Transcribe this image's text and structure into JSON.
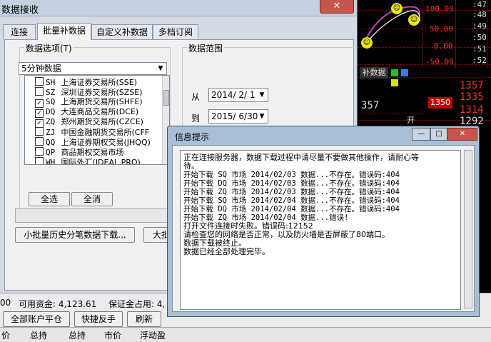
{
  "colors": {
    "accent_red": "#ff3030",
    "dialog_blue": "#a9bfd6",
    "window_frame": "#d4dbe4"
  },
  "background": {
    "right_prices": [
      "100.00",
      "50.00",
      "0.00",
      "-50.00"
    ],
    "far_right_ticks": [
      ":47",
      ":48",
      ":49",
      ":50",
      ":51",
      ":52"
    ],
    "tab_label": "补数据",
    "badge": "1350",
    "price_357": "357",
    "price_list": [
      "1357",
      "1335",
      "1314",
      "1292"
    ],
    "label_open": "开",
    "capital_label": "可用资金: 4,123.61",
    "margin_label": "保证金占用: 4,",
    "left_digits": "00",
    "buttons": [
      "全部账户平仓",
      "快捷反手",
      "刷新"
    ],
    "columns": [
      "价",
      "总持",
      "总持",
      "市价",
      "浮动盈"
    ]
  },
  "main_window": {
    "title": "数据接收",
    "close_icon": "✕",
    "tabs": [
      "连接",
      "批量补数据",
      "自定义补数据",
      "多档订阅"
    ],
    "options_label": "数据选项(T)",
    "period_value": "5分钟数据",
    "dropdown_icon": "▼",
    "checkmark": "✓",
    "exchanges": [
      {
        "code": "SH",
        "name": "上海证券交易所(SSE)",
        "checked": false
      },
      {
        "code": "SZ",
        "name": "深圳证券交易所(SZSE)",
        "checked": false
      },
      {
        "code": "SQ",
        "name": "上海期货交易所(SHFE)",
        "checked": true
      },
      {
        "code": "DQ",
        "name": "大连商品交易所(DCE)",
        "checked": true
      },
      {
        "code": "ZQ",
        "name": "郑州期货交易所(CZCE)",
        "checked": true
      },
      {
        "code": "ZJ",
        "name": "中国金融期货交易所(CFF",
        "checked": false
      },
      {
        "code": "QQ",
        "name": "上海证券期权交易(JHQQ)",
        "checked": false
      },
      {
        "code": "QP",
        "name": "商品期权交易市场",
        "checked": false
      },
      {
        "code": "WH",
        "name": "国际外汇(IDEAL PRO)",
        "checked": false
      }
    ],
    "select_all": "全选",
    "select_none": "全消",
    "small_batch_button": "小批量历史分笔数据下载...",
    "large_batch_button": "大批量",
    "range_label": "数据范围",
    "from_label": "从",
    "from_date": "2014/ 2/ 1",
    "to_label": "到",
    "to_date": "2015/ 6/30"
  },
  "info_dialog": {
    "title": "信息提示",
    "minimize": "—",
    "maximize": "□",
    "close": "✕",
    "lines": [
      "正在连接服务器，数据下载过程中请尽量不要做其他操作，请耐心等",
      "待。",
      "开始下载 SQ 市场 2014/02/03 数据...不存在。错误码:404",
      "开始下载 DQ 市场 2014/02/03 数据...不存在。错误码:404",
      "开始下载 ZQ 市场 2014/02/03 数据...不存在。错误码:404",
      "开始下载 SQ 市场 2014/02/04 数据...不存在。错误码:404",
      "开始下载 DQ 市场 2014/02/04 数据...不存在。错误码:404",
      "开始下载 ZQ 市场 2014/02/04 数据...错误!",
      "打开文件连接时失败。错误码:12152",
      "请检查您的网络是否正常，以及防火墙是否屏蔽了80端口。",
      "数据下载被终止。",
      "数据已经全部处理完毕。"
    ]
  }
}
